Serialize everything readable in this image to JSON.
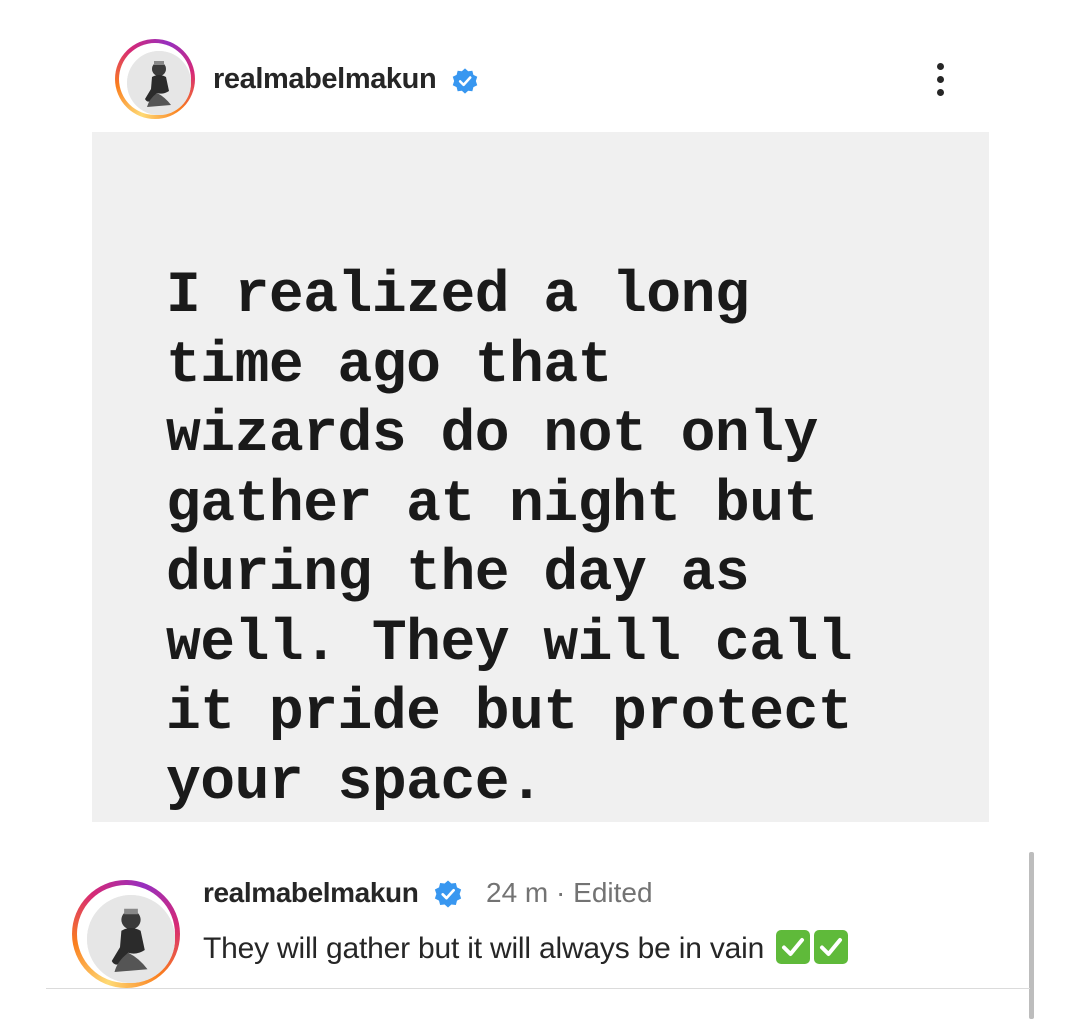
{
  "post": {
    "username": "realmabelmakun",
    "avatar_icon": "profile-photo",
    "verified_icon": "verified-badge-icon",
    "more_icon": "more-options-icon",
    "image_text": "I realized a long\ntime ago that\nwizards do not only\ngather at night but\nduring the day as\nwell. They will call\nit pride but protect\nyour space.",
    "image_background": "#f0f0f0"
  },
  "caption": {
    "username": "realmabelmakun",
    "time": "24 m",
    "separator": "·",
    "edited": "Edited",
    "text": "They will gather but it will always be in vain",
    "emoji_icons": [
      "check-mark-button-icon",
      "check-mark-button-icon"
    ]
  },
  "colors": {
    "verified_blue": "#3897f0",
    "check_green": "#5fba3a",
    "meta_gray": "#737373"
  }
}
